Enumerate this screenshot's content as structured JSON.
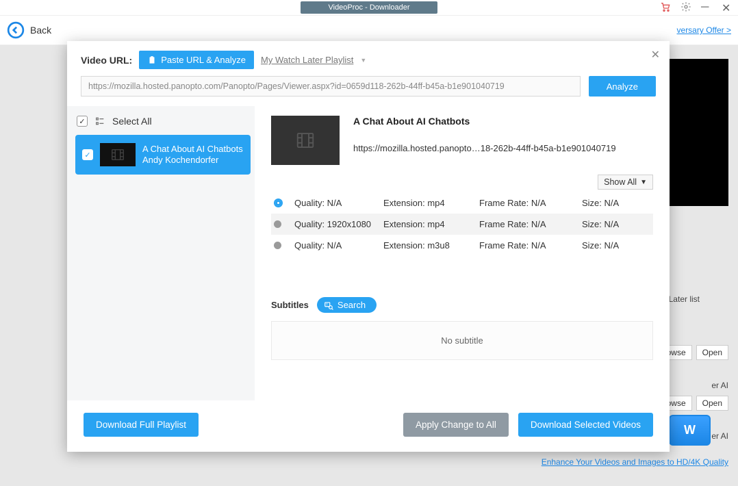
{
  "titlebar": {
    "title": "VideoProc - Downloader"
  },
  "toolbar": {
    "back": "Back",
    "offer": "versary Offer >"
  },
  "stage": {
    "later_label": "ch Later list",
    "browse": "rowse",
    "open": "Open",
    "ai": "er AI",
    "download_now": "W",
    "enhance": "Enhance Your Videos and Images to HD/4K Quality"
  },
  "modal": {
    "url_label": "Video URL:",
    "paste_btn": "Paste URL & Analyze",
    "watch_later": "My Watch Later Playlist",
    "url_value": "https://mozilla.hosted.panopto.com/Panopto/Pages/Viewer.aspx?id=0659d118-262b-44ff-b45a-b1e901040719",
    "analyze": "Analyze",
    "select_all": "Select All",
    "item": {
      "title": "A Chat About AI Chatbots",
      "author": "Andy Kochendorfer"
    },
    "detail": {
      "title": "A Chat About AI Chatbots",
      "url": "https://mozilla.hosted.panopto…18-262b-44ff-b45a-b1e901040719",
      "show_all": "Show All"
    },
    "formats": [
      {
        "sel": true,
        "quality": "Quality: N/A",
        "ext": "Extension: mp4",
        "fr": "Frame Rate: N/A",
        "size": "Size: N/A"
      },
      {
        "sel": false,
        "quality": "Quality: 1920x1080",
        "ext": "Extension: mp4",
        "fr": "Frame Rate: N/A",
        "size": "Size: N/A"
      },
      {
        "sel": false,
        "quality": "Quality: N/A",
        "ext": "Extension: m3u8",
        "fr": "Frame Rate: N/A",
        "size": "Size: N/A"
      }
    ],
    "subs": {
      "label": "Subtitles",
      "search": "Search",
      "empty": "No subtitle"
    },
    "footer": {
      "playlist": "Download Full Playlist",
      "apply": "Apply Change to All",
      "dl_selected": "Download Selected Videos"
    }
  }
}
